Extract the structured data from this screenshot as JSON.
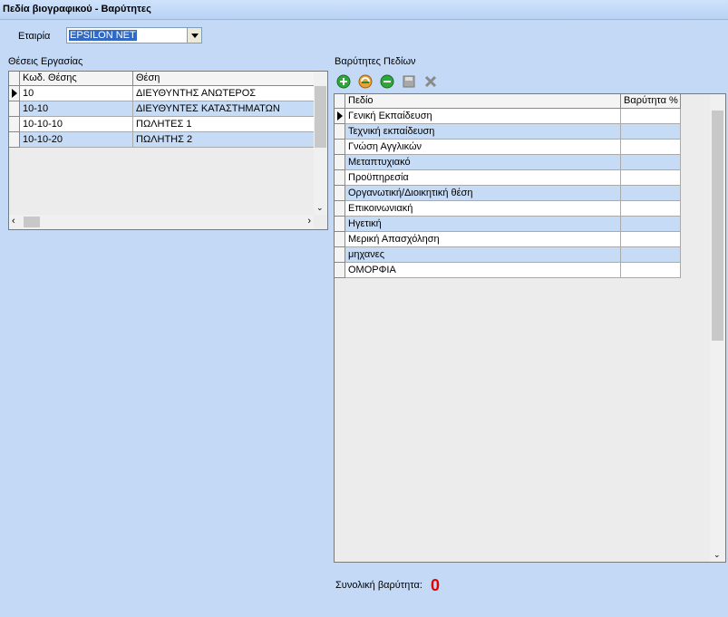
{
  "window": {
    "title": "Πεδία βιογραφικού - Βαρύτητες"
  },
  "company": {
    "label": "Εταιρία",
    "value": "EPSILON NET"
  },
  "positions": {
    "title": "Θέσεις Εργασίας",
    "columns": [
      "Κωδ. Θέσης",
      "Θέση"
    ],
    "rows": [
      {
        "code": "10",
        "name": "ΔΙΕΥΘΥΝΤΗΣ ΑΝΩΤΕΡΟΣ"
      },
      {
        "code": "10-10",
        "name": "ΔΙΕΥΘΥΝΤΕΣ ΚΑΤΑΣΤΗΜΑΤΩΝ"
      },
      {
        "code": "10-10-10",
        "name": "ΠΩΛΗΤΕΣ 1"
      },
      {
        "code": "10-10-20",
        "name": "ΠΩΛΗΤΗΣ 2"
      }
    ]
  },
  "weights": {
    "title": "Βαρύτητες Πεδίων",
    "toolbar": [
      "add-icon",
      "refresh-icon",
      "remove-icon",
      "save-icon",
      "tools-icon"
    ],
    "columns": [
      "Πεδίο",
      "Βαρύτητα %"
    ],
    "rows": [
      {
        "field": "Γενική Εκπαίδευση",
        "weight": ""
      },
      {
        "field": "Τεχνική εκπαίδευση",
        "weight": ""
      },
      {
        "field": "Γνώση Αγγλικών",
        "weight": ""
      },
      {
        "field": "Μεταπτυχιακό",
        "weight": ""
      },
      {
        "field": "Προϋπηρεσία",
        "weight": ""
      },
      {
        "field": "Οργανωτική/Διοικητική θέση",
        "weight": ""
      },
      {
        "field": "Επικοινωνιακή",
        "weight": ""
      },
      {
        "field": "Ηγετική",
        "weight": ""
      },
      {
        "field": "Μερική Απασχόληση",
        "weight": ""
      },
      {
        "field": "μηχανες",
        "weight": ""
      },
      {
        "field": "ΟΜΟΡΦΙΑ",
        "weight": ""
      }
    ]
  },
  "total": {
    "label": "Συνολική βαρύτητα:",
    "value": "0"
  }
}
